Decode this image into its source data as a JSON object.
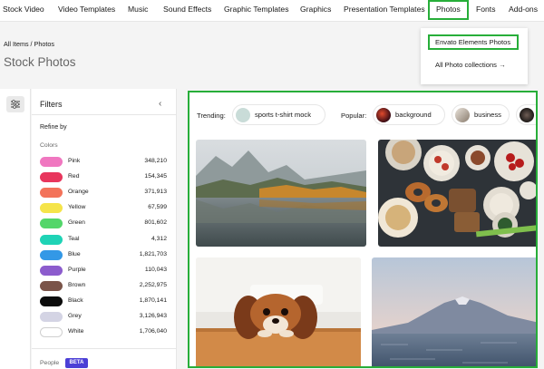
{
  "nav": {
    "items": [
      "Stock Video",
      "Video Templates",
      "Music",
      "Sound Effects",
      "Graphic Templates",
      "Graphics",
      "Presentation Templates",
      "Photos",
      "Fonts",
      "Add-ons"
    ],
    "active": "Photos"
  },
  "dropdown": {
    "primary": "Envato Elements Photos",
    "secondary": "All Photo collections →"
  },
  "breadcrumb": "All Items / Photos",
  "page_title": "Stock Photos",
  "sidebar": {
    "title": "Filters",
    "refine_label": "Refine by",
    "colors_label": "Colors",
    "colors": [
      {
        "name": "Pink",
        "count": "348,210",
        "color": "#f077c0"
      },
      {
        "name": "Red",
        "count": "154,345",
        "color": "#e8365d"
      },
      {
        "name": "Orange",
        "count": "371,913",
        "color": "#f3735a"
      },
      {
        "name": "Yellow",
        "count": "67,599",
        "color": "#f5e44a"
      },
      {
        "name": "Green",
        "count": "801,602",
        "color": "#53d66a"
      },
      {
        "name": "Teal",
        "count": "4,312",
        "color": "#1fd3b6"
      },
      {
        "name": "Blue",
        "count": "1,821,703",
        "color": "#3398e6"
      },
      {
        "name": "Purple",
        "count": "110,043",
        "color": "#8c5ccd"
      },
      {
        "name": "Brown",
        "count": "2,252,975",
        "color": "#7a5449"
      },
      {
        "name": "Black",
        "count": "1,870,141",
        "color": "#0c0c0c"
      },
      {
        "name": "Grey",
        "count": "3,126,943",
        "color": "#d4d4e4"
      },
      {
        "name": "White",
        "count": "1,706,040",
        "color": "#ffffff"
      }
    ],
    "people_label": "People",
    "beta": "BETA"
  },
  "trending": {
    "label": "Trending:",
    "chip": "sports t-shirt mock"
  },
  "popular": {
    "label": "Popular:",
    "chips": [
      "background",
      "business"
    ]
  },
  "colors": {
    "accent_green": "#27ae39",
    "beta_purple": "#4b3fd6"
  },
  "icons": [
    "filter-sliders-icon",
    "chevron-left-icon",
    "arrow-right-icon"
  ]
}
